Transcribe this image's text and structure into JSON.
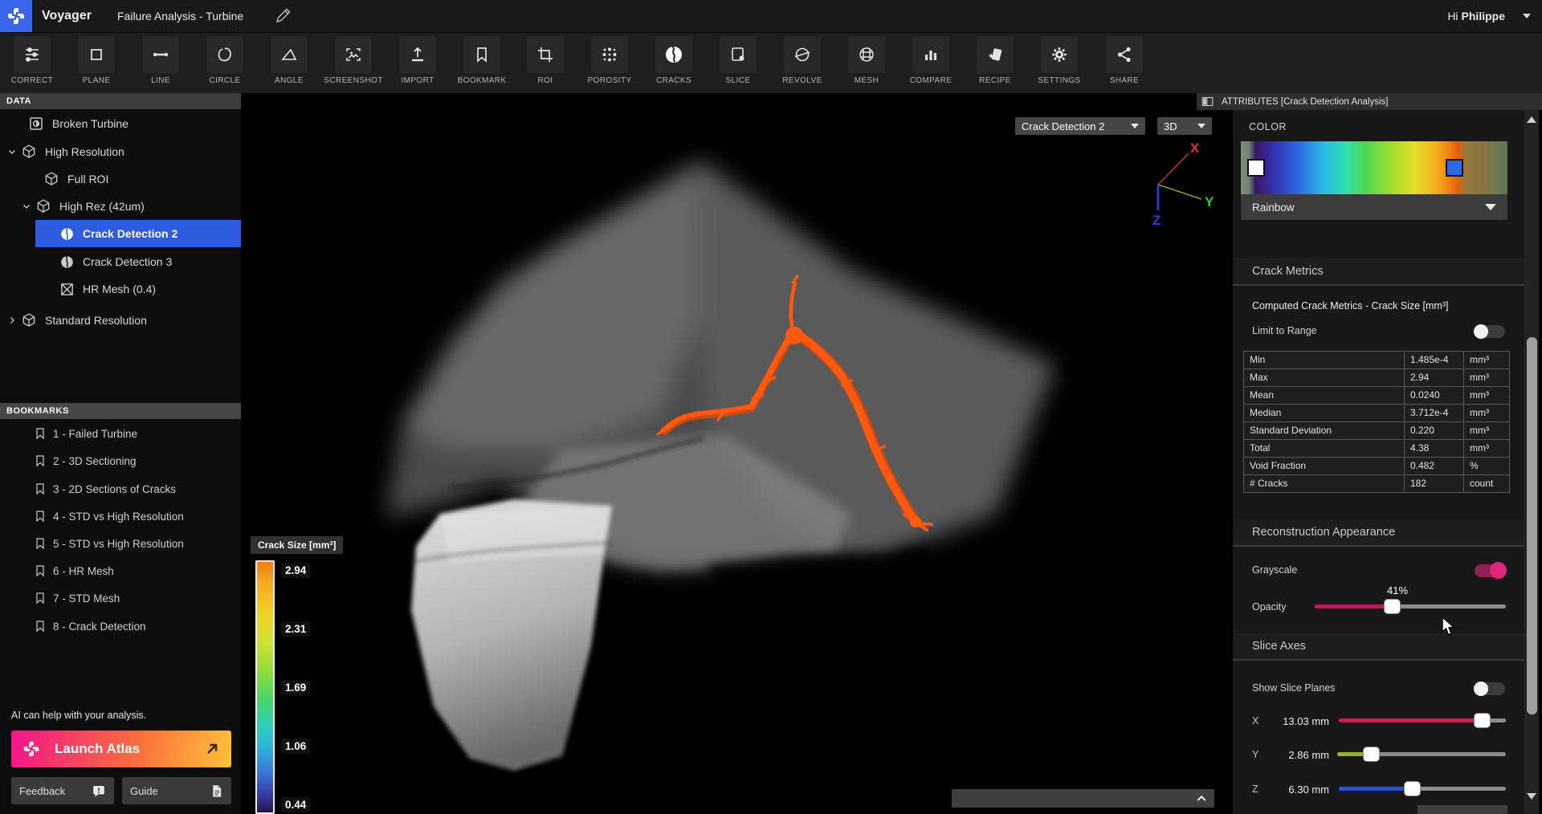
{
  "app": {
    "name": "Voyager",
    "project_title": "Failure Analysis - Turbine",
    "greeting": "Hi",
    "user": "Philippe"
  },
  "toolbar": {
    "items": [
      {
        "label": "CORRECT"
      },
      {
        "label": "PLANE"
      },
      {
        "label": "LINE"
      },
      {
        "label": "CIRCLE"
      },
      {
        "label": "ANGLE"
      },
      {
        "label": "SCREENSHOT"
      },
      {
        "label": "IMPORT"
      },
      {
        "label": "BOOKMARK"
      },
      {
        "label": "ROI"
      },
      {
        "label": "POROSITY"
      },
      {
        "label": "CRACKS"
      },
      {
        "label": "SLICE"
      },
      {
        "label": "REVOLVE"
      },
      {
        "label": "MESH"
      },
      {
        "label": "COMPARE"
      },
      {
        "label": "RECIPE"
      },
      {
        "label": "SETTINGS"
      },
      {
        "label": "SHARE"
      }
    ]
  },
  "sidebar": {
    "data_header": "DATA",
    "tree": [
      {
        "label": "Broken Turbine"
      },
      {
        "label": "High Resolution"
      },
      {
        "label": "Full ROI"
      },
      {
        "label": "High Rez (42um)"
      },
      {
        "label": "Crack Detection 2"
      },
      {
        "label": "Crack Detection 3"
      },
      {
        "label": "HR Mesh (0.4)"
      },
      {
        "label": "Standard Resolution"
      }
    ],
    "bookmarks_header": "BOOKMARKS",
    "bookmarks": [
      {
        "label": "1 - Failed Turbine"
      },
      {
        "label": "2 - 3D Sectioning"
      },
      {
        "label": "3 - 2D Sections of Cracks"
      },
      {
        "label": "4 - STD vs High Resolution"
      },
      {
        "label": "5 - STD vs High Resolution"
      },
      {
        "label": "6 - HR Mesh"
      },
      {
        "label": "7 - STD Mesh"
      },
      {
        "label": "8 - Crack Detection"
      }
    ]
  },
  "ai_panel": {
    "message": "AI can help with your analysis.",
    "launch_button": "Launch Atlas",
    "feedback_button": "Feedback",
    "guide_button": "Guide"
  },
  "viewport": {
    "layer_dropdown": "Crack Detection 2",
    "view_mode_dropdown": "3D",
    "axis_labels": {
      "x": "X",
      "y": "Y",
      "z": "Z"
    },
    "legend": {
      "title": "Crack Size [mm³]",
      "ticks": [
        "2.94",
        "2.31",
        "1.69",
        "1.06",
        "0.44"
      ]
    }
  },
  "attributes": {
    "header": "ATTRIBUTES [Crack Detection Analysis]",
    "color": {
      "label": "COLOR",
      "colormap": "Rainbow"
    },
    "crack_metrics": {
      "title": "Crack Metrics",
      "subtitle": "Computed Crack Metrics - Crack Size [mm³]",
      "limit_to_range_label": "Limit to Range",
      "limit_to_range_on": false,
      "table": [
        {
          "metric": "Min",
          "value": "1.485e-4",
          "unit": "mm³"
        },
        {
          "metric": "Max",
          "value": "2.94",
          "unit": "mm³"
        },
        {
          "metric": "Mean",
          "value": "0.0240",
          "unit": "mm³"
        },
        {
          "metric": "Median",
          "value": "3.712e-4",
          "unit": "mm³"
        },
        {
          "metric": "Standard Deviation",
          "value": "0.220",
          "unit": "mm³"
        },
        {
          "metric": "Total",
          "value": "4.38",
          "unit": "mm³"
        },
        {
          "metric": "Void Fraction",
          "value": "0.482",
          "unit": "%"
        },
        {
          "metric": "# Cracks",
          "value": "182",
          "unit": "count"
        }
      ]
    },
    "reconstruction": {
      "title": "Reconstruction Appearance",
      "grayscale_label": "Grayscale",
      "grayscale_on": true,
      "opacity_label": "Opacity",
      "opacity_value": "41%"
    },
    "slice_axes": {
      "title": "Slice Axes",
      "show_slice_planes_label": "Show Slice Planes",
      "show_slice_planes_on": false,
      "sliders": [
        {
          "axis": "X",
          "value": "13.03 mm",
          "color": "#d6194b"
        },
        {
          "axis": "Y",
          "value": "2.86 mm",
          "color": "#96b42c"
        },
        {
          "axis": "Z",
          "value": "6.30 mm",
          "color": "#2353e0"
        }
      ]
    }
  },
  "colors": {
    "accent_blue": "#2e5be0",
    "crack_orange": "#ff5a10",
    "toggle_pink": "#e0267c",
    "atlas_gradient_start": "#f2158a",
    "atlas_gradient_end": "#ffc23a"
  }
}
